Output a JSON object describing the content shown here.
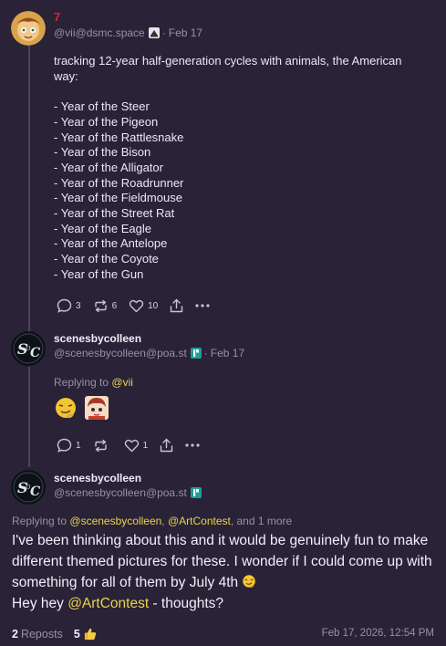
{
  "posts": [
    {
      "display_name": "7",
      "handle": "@vii@dsmc.space",
      "date": "Feb 17",
      "body": "tracking 12-year half-generation cycles with animals, the American way:\n\n- Year of the Steer\n- Year of the Pigeon\n- Year of the Rattlesnake\n- Year of the Bison\n- Year of the Alligator\n- Year of the Roadrunner\n- Year of the Fieldmouse\n- Year of the Street Rat\n- Year of the Eagle\n- Year of the Antelope\n- Year of the Coyote\n- Year of the Gun",
      "replies": "3",
      "reposts": "6",
      "likes": "10"
    },
    {
      "display_name": "scenesbycolleen",
      "handle": "@scenesbycolleen@poa.st",
      "date": "Feb 17",
      "replying_label": "Replying to",
      "replying_to": "@vii",
      "replies": "1",
      "reposts": "",
      "likes": "1"
    }
  ],
  "focus": {
    "display_name": "scenesbycolleen",
    "handle": "@scenesbycolleen@poa.st",
    "replying_label": "Replying to",
    "mention_1": "@scenesbycolleen",
    "mention_2": "@ArtContest",
    "and_more": ", and 1 more",
    "body_1": "I've been thinking about this and it would be genuinely fun to make different themed pictures for these.  I wonder if I could come up with something for all of them by July 4th",
    "body_2": "Hey hey",
    "mention_body": "@ArtContest",
    "body_3": " - thoughts?",
    "reposts_count": "2",
    "reposts_label": "Reposts",
    "likes_count": "5",
    "timestamp": "Feb 17, 2026, 12:54 PM"
  },
  "icons": {
    "reply": "reply-icon",
    "repost": "repost-icon",
    "like": "heart-icon",
    "share": "share-icon",
    "more": "more-icon",
    "thumbs": "thumbs-up-icon"
  },
  "colors": {
    "background": "#2a2236",
    "mention": "#e8d44e",
    "name_red": "#e0242c",
    "muted": "#9a90ab"
  }
}
